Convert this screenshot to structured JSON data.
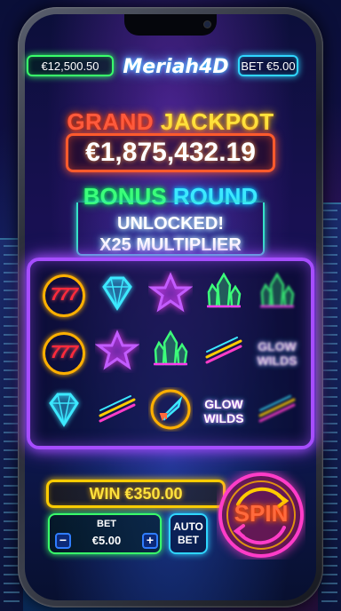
{
  "header": {
    "balance": "€12,500.50",
    "logo": "Meriah4D",
    "bet": "BET €5.00"
  },
  "jackpot": {
    "title_left": "GRAND",
    "title_right": "JACKPOT",
    "amount": "€1,875,432.19"
  },
  "bonus": {
    "title_left": "BONUS",
    "title_right": "ROUND",
    "line1": "UNLOCKED!",
    "line2": "X25 MULTIPLIER"
  },
  "reels": {
    "seven_label": "777",
    "glow_line1": "GLOW",
    "glow_line2": "WILDS",
    "symbols": [
      "seven-icon",
      "diamond-icon",
      "star-icon",
      "crystal-icon",
      "crystal-icon",
      "seven-icon",
      "star-icon",
      "crystal-icon",
      "streak-icon",
      "glow-wilds-icon",
      "diamond-icon",
      "streak-icon",
      "rocket-icon",
      "glow-wilds-icon",
      "streak-icon"
    ]
  },
  "controls": {
    "win": "WIN €350.00",
    "bet_label": "BET",
    "bet_value": "€5.00",
    "minus": "−",
    "plus": "+",
    "auto_line1": "AUTO",
    "auto_line2": "BET",
    "spin": "SPIN"
  },
  "colors": {
    "neon_green": "#39ff6a",
    "neon_cyan": "#2fd6ff",
    "neon_purple": "#a64dff",
    "neon_orange": "#ff5a2c",
    "neon_yellow": "#ffcc00"
  }
}
